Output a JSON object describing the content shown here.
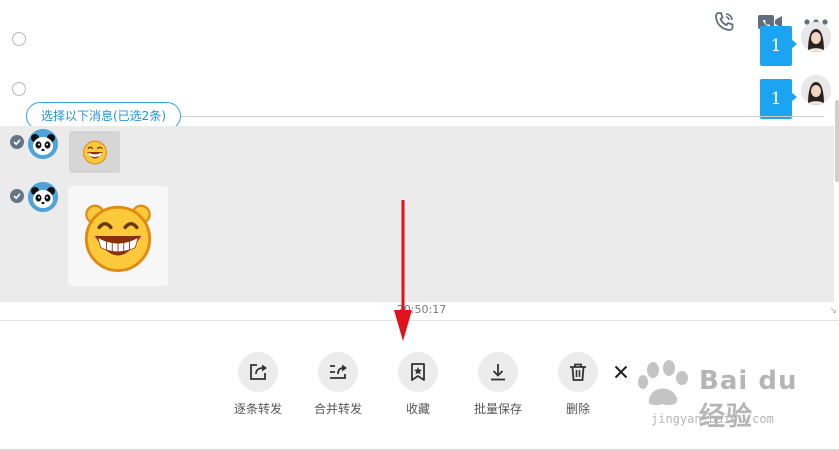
{
  "header": {
    "icons": [
      "phone-call-icon",
      "video-call-icon",
      "more-options-icon"
    ]
  },
  "messages": {
    "right": [
      {
        "text": "1"
      },
      {
        "text": "1"
      }
    ],
    "selection_banner": "选择以下消息(已选2条)",
    "timestamp": "20:50:17"
  },
  "actions": [
    {
      "label": "逐条转发",
      "icon": "forward-one-by-one-icon"
    },
    {
      "label": "合并转发",
      "icon": "merge-forward-icon"
    },
    {
      "label": "收藏",
      "icon": "favorite-icon"
    },
    {
      "label": "批量保存",
      "icon": "batch-save-icon"
    },
    {
      "label": "删除",
      "icon": "delete-icon"
    }
  ],
  "watermark": {
    "brand": "Bai du 经验",
    "url": "jingyan.baidu.com"
  },
  "colors": {
    "accent": "#1aa4f1",
    "selection_bg": "#ebebeb",
    "arrow": "#e0121b",
    "check": "#637686"
  }
}
